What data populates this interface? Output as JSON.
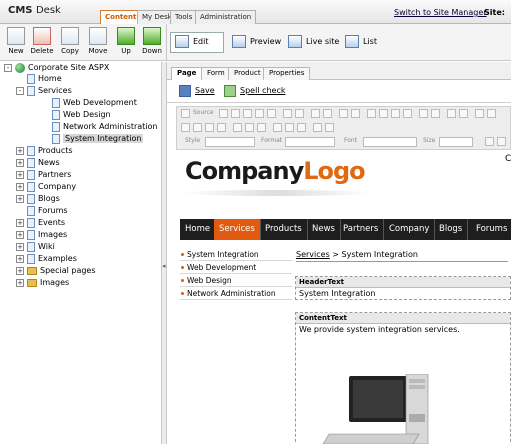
{
  "header": {
    "brand_main": "CMS",
    "brand_sub": "Desk",
    "tabs": [
      {
        "label": "Content",
        "active": true
      },
      {
        "label": "My Desk",
        "active": false
      },
      {
        "label": "Tools",
        "active": false
      },
      {
        "label": "Administration",
        "active": false
      }
    ],
    "site_manager_link": "Switch to Site Manager",
    "site_label": "Site:"
  },
  "toolbar": {
    "buttons": [
      {
        "label": "New",
        "icon": "new-document-icon"
      },
      {
        "label": "Delete",
        "icon": "delete-icon"
      },
      {
        "label": "Copy",
        "icon": "copy-icon"
      },
      {
        "label": "Move",
        "icon": "move-icon"
      },
      {
        "label": "Up",
        "icon": "arrow-up-icon"
      },
      {
        "label": "Down",
        "icon": "arrow-down-icon"
      }
    ]
  },
  "modes": [
    {
      "label": "Edit",
      "icon": "edit-icon"
    },
    {
      "label": "Preview",
      "icon": "preview-icon"
    },
    {
      "label": "Live site",
      "icon": "live-site-icon"
    },
    {
      "label": "List",
      "icon": "list-icon"
    }
  ],
  "tree": {
    "root": "Corporate Site ASPX",
    "items": [
      {
        "label": "Home",
        "expander": "",
        "icon": "page"
      },
      {
        "label": "Services",
        "expander": "-",
        "icon": "page"
      },
      {
        "label": "Web Development",
        "expander": "",
        "icon": "page"
      },
      {
        "label": "Web Design",
        "expander": "",
        "icon": "page"
      },
      {
        "label": "Network Administration",
        "expander": "",
        "icon": "page"
      },
      {
        "label": "System Integration",
        "expander": "",
        "icon": "page",
        "selected": true
      },
      {
        "label": "Products",
        "expander": "+",
        "icon": "page"
      },
      {
        "label": "News",
        "expander": "+",
        "icon": "page"
      },
      {
        "label": "Partners",
        "expander": "+",
        "icon": "page"
      },
      {
        "label": "Company",
        "expander": "+",
        "icon": "page"
      },
      {
        "label": "Blogs",
        "expander": "+",
        "icon": "page"
      },
      {
        "label": "Forums",
        "expander": "",
        "icon": "page"
      },
      {
        "label": "Events",
        "expander": "+",
        "icon": "page"
      },
      {
        "label": "Images",
        "expander": "+",
        "icon": "page"
      },
      {
        "label": "Wiki",
        "expander": "+",
        "icon": "page"
      },
      {
        "label": "Examples",
        "expander": "+",
        "icon": "page"
      },
      {
        "label": "Special pages",
        "expander": "+",
        "icon": "folder"
      },
      {
        "label": "Images",
        "expander": "+",
        "icon": "folder"
      }
    ]
  },
  "page_tabs": [
    {
      "label": "Page",
      "active": true
    },
    {
      "label": "Form",
      "active": false
    },
    {
      "label": "Product",
      "active": false
    },
    {
      "label": "Properties",
      "active": false
    }
  ],
  "actions": {
    "save": "Save",
    "spell_check": "Spell check"
  },
  "editor": {
    "source_label": "Source",
    "style_label": "Style",
    "format_label": "Format",
    "font_label": "Font",
    "size_label": "Size"
  },
  "site": {
    "logo_part1": "Company",
    "logo_part2": "Logo",
    "edge_char": "C",
    "nav": [
      {
        "label": "Home",
        "active": false
      },
      {
        "label": "Services",
        "active": true
      },
      {
        "label": "Products",
        "active": false
      },
      {
        "label": "News",
        "active": false
      },
      {
        "label": "Partners",
        "active": false
      },
      {
        "label": "Company",
        "active": false
      },
      {
        "label": "Blogs",
        "active": false
      },
      {
        "label": "Forums",
        "active": false
      }
    ],
    "subnav": [
      "System Integration",
      "Web Development",
      "Web Design",
      "Network Administration"
    ],
    "breadcrumb_link": "Services",
    "breadcrumb_sep": " > ",
    "breadcrumb_current": "System Integration",
    "header_box_title": "HeaderText",
    "header_box_value": "System Integration",
    "content_box_title": "ContentText",
    "content_box_value": "We provide system integration services."
  },
  "colors": {
    "accent": "#e05a10",
    "nav_bg": "#1e1e1e",
    "tab_active": "#d05a00"
  }
}
